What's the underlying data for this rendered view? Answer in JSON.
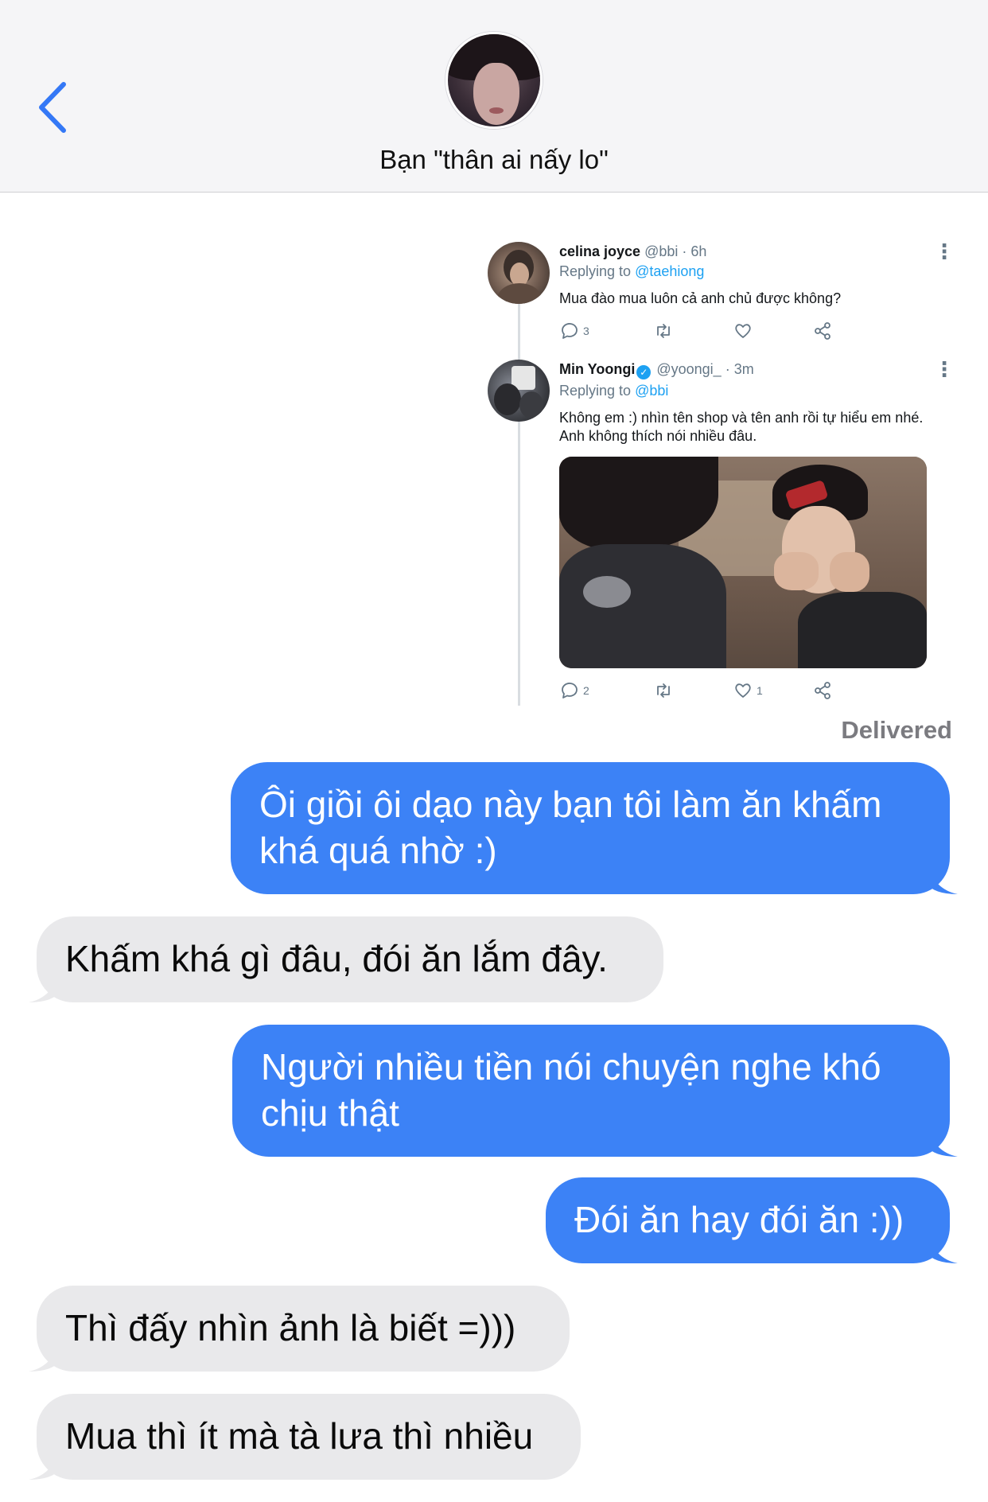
{
  "header": {
    "contact_name": "Bạn \"thân ai nấy lo\"",
    "back_icon": "chevron-left-icon",
    "accent_color": "#3478f6"
  },
  "tweet_thread": {
    "tweets": [
      {
        "name": "celina joyce",
        "handle": "@bbi",
        "time": "6h",
        "replying_label": "Replying to",
        "replying_to": "@taehiong",
        "text": "Mua đào mua luôn cả anh chủ được không?",
        "reply_count": "3",
        "like_count": ""
      },
      {
        "name": "Min Yoongi",
        "handle": "@yoongi_",
        "time": "3m",
        "verified": true,
        "replying_label": "Replying to",
        "replying_to": "@bbi",
        "text": "Không em :) nhìn tên shop và tên anh rồi tự hiểu em nhé. Anh không thích nói nhiều đâu.",
        "reply_count": "2",
        "like_count": "1"
      }
    ]
  },
  "status": {
    "delivered": "Delivered"
  },
  "messages": [
    {
      "from": "me",
      "text": "Ôi giồi ôi dạo này bạn tôi làm ăn khấm khá quá nhờ :)"
    },
    {
      "from": "them",
      "text": "Khấm khá gì đâu, đói ăn lắm đây."
    },
    {
      "from": "me",
      "text": "Người nhiều tiền nói chuyện nghe khó chịu thật"
    },
    {
      "from": "me",
      "text": "Đói ăn hay đói ăn :))"
    },
    {
      "from": "them",
      "text": "Thì đấy nhìn ảnh là biết =)))"
    },
    {
      "from": "them",
      "text": "Mua thì ít mà tà lưa thì nhiều"
    }
  ],
  "colors": {
    "sent_bubble": "#3c82f6",
    "received_bubble": "#e9e9eb",
    "twitter_blue": "#1da1f2"
  }
}
